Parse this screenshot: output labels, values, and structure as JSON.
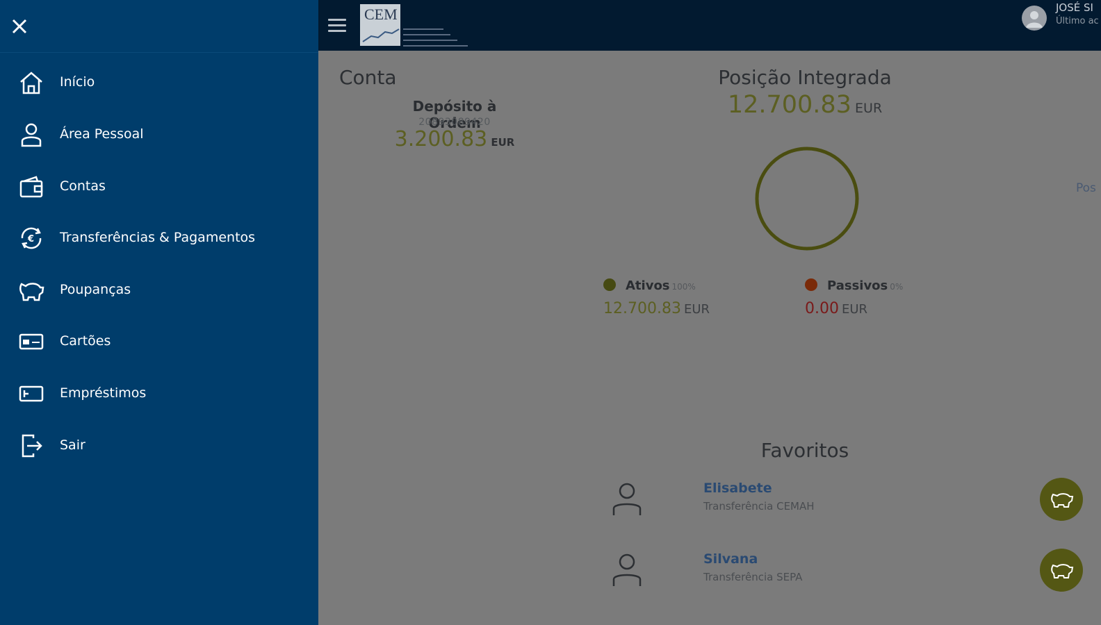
{
  "header": {
    "logo_text": "CEM",
    "user_name": "JOSÉ SI",
    "user_sub": "Último ac"
  },
  "drawer": {
    "items": [
      {
        "label": "Início",
        "icon": "home-icon"
      },
      {
        "label": "Área Pessoal",
        "icon": "person-icon"
      },
      {
        "label": "Contas",
        "icon": "wallet-icon"
      },
      {
        "label": "Transferências & Pagamentos",
        "icon": "transfer-icon"
      },
      {
        "label": "Poupanças",
        "icon": "piggy-bank-icon"
      },
      {
        "label": "Cartões",
        "icon": "card-icon"
      },
      {
        "label": "Empréstimos",
        "icon": "loan-icon"
      },
      {
        "label": "Sair",
        "icon": "logout-icon"
      }
    ]
  },
  "conta": {
    "title": "Conta",
    "account_name": "Depósito à Ordem",
    "account_number": "20893089420",
    "balance": "3.200.83",
    "currency": "EUR"
  },
  "posicao": {
    "title": "Posição Integrada",
    "value": "12.700.83",
    "currency": "EUR",
    "side_label": "Pos",
    "ativos": {
      "label": "Ativos",
      "pct": "100%",
      "value": "12.700.83",
      "currency": "EUR",
      "color": "#464a12"
    },
    "passivos": {
      "label": "Passivos",
      "pct": "0%",
      "value": "0.00",
      "currency": "EUR",
      "color": "#7a2a08"
    },
    "ring_color": "#4a4d10"
  },
  "favoritos": {
    "title": "Favoritos",
    "items": [
      {
        "name": "Elisabete",
        "type": "Transferência CEMAH"
      },
      {
        "name": "Silvana",
        "type": "Transferência SEPA"
      }
    ]
  }
}
